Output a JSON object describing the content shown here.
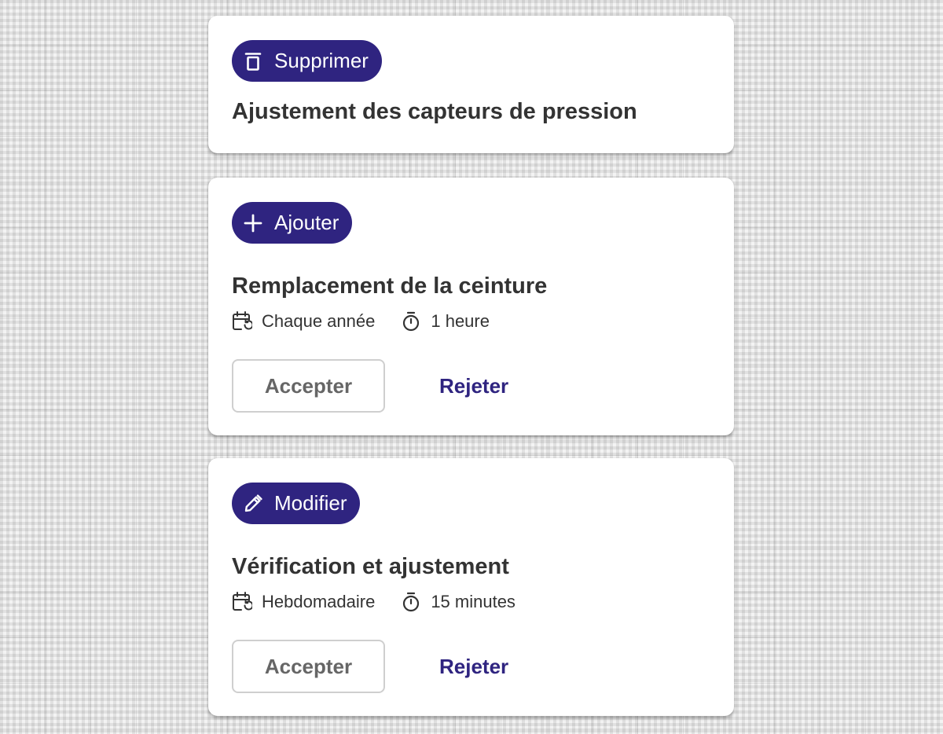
{
  "cards": [
    {
      "badge": {
        "label": "Supprimer",
        "icon": "trash-icon"
      },
      "title": "Ajustement des capteurs de pression"
    },
    {
      "badge": {
        "label": "Ajouter",
        "icon": "plus-icon"
      },
      "title": "Remplacement de la ceinture",
      "frequency": {
        "icon": "calendar-repeat-icon",
        "label": "Chaque année"
      },
      "duration": {
        "icon": "timer-icon",
        "label": "1 heure"
      },
      "actions": {
        "accept_label": "Accepter",
        "reject_label": "Rejeter"
      }
    },
    {
      "badge": {
        "label": "Modifier",
        "icon": "pencil-icon"
      },
      "title": "Vérification et ajustement",
      "frequency": {
        "icon": "calendar-repeat-icon",
        "label": "Hebdomadaire"
      },
      "duration": {
        "icon": "timer-icon",
        "label": "15 minutes"
      },
      "actions": {
        "accept_label": "Accepter",
        "reject_label": "Rejeter"
      }
    }
  ],
  "colors": {
    "accent": "#2f2480",
    "title_text": "#333333",
    "accept_text": "#666666",
    "accept_border": "#cfcfcf",
    "card_bg": "#ffffff",
    "page_bg": "#f3f3f3"
  }
}
